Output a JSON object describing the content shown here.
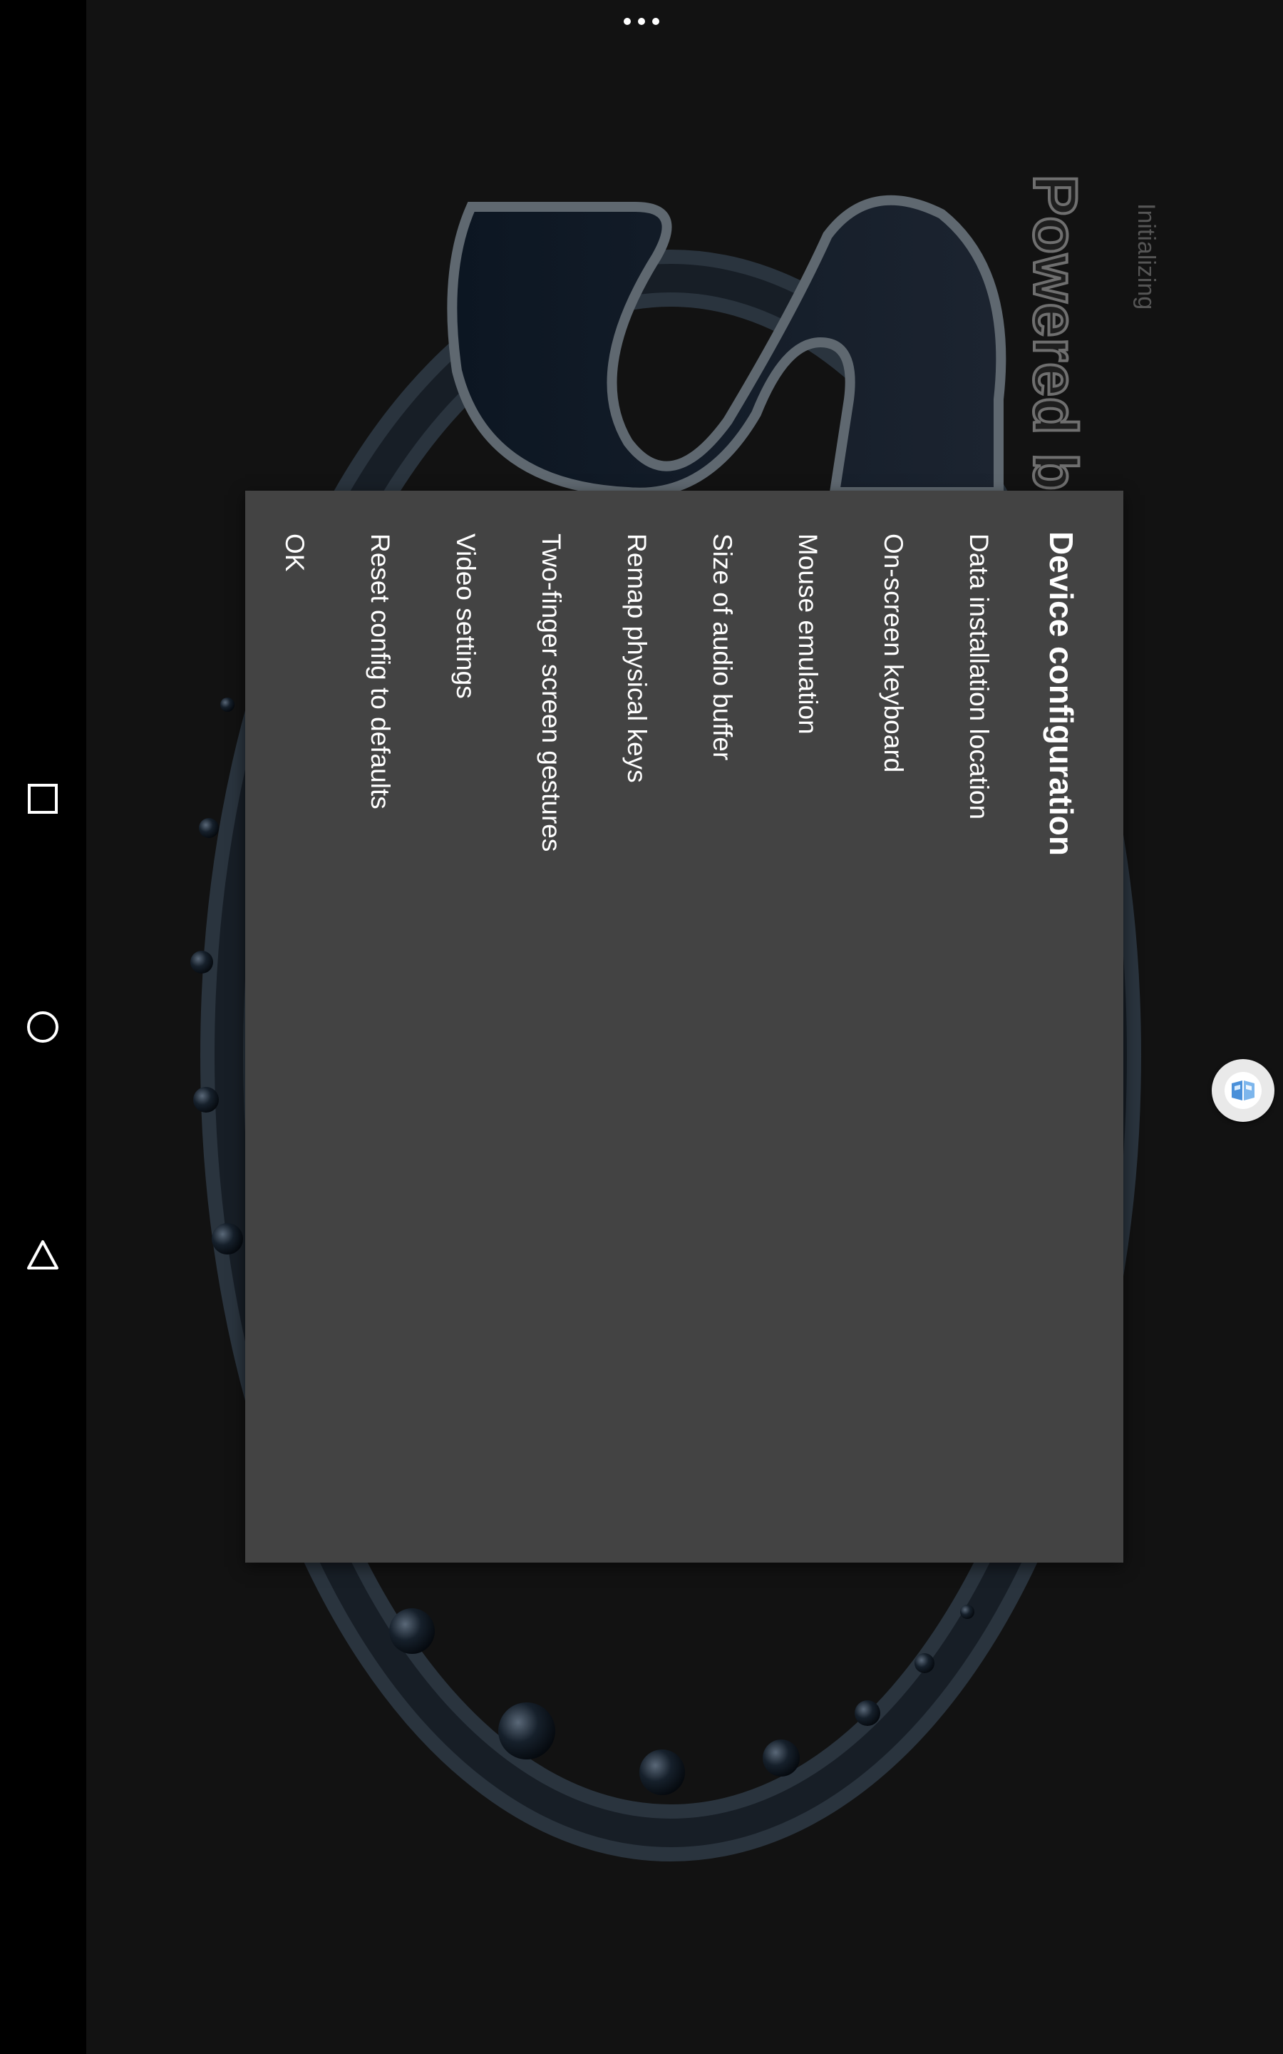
{
  "splash": {
    "powered_text": "Powered b",
    "status_text": "Initializing"
  },
  "dialog": {
    "title": "Device configuration",
    "items": [
      "Data installation location",
      "On-screen keyboard",
      "Mouse emulation",
      "Size of audio buffer",
      "Remap physical keys",
      "Two-finger screen gestures",
      "Video settings",
      "Reset config to defaults",
      "OK"
    ]
  },
  "navbar": {
    "icons": [
      "recents-icon",
      "home-icon",
      "back-icon"
    ]
  },
  "colors": {
    "background": "#121212",
    "dialog": "#434343",
    "navbar": "#000000",
    "text": "#ffffff"
  }
}
